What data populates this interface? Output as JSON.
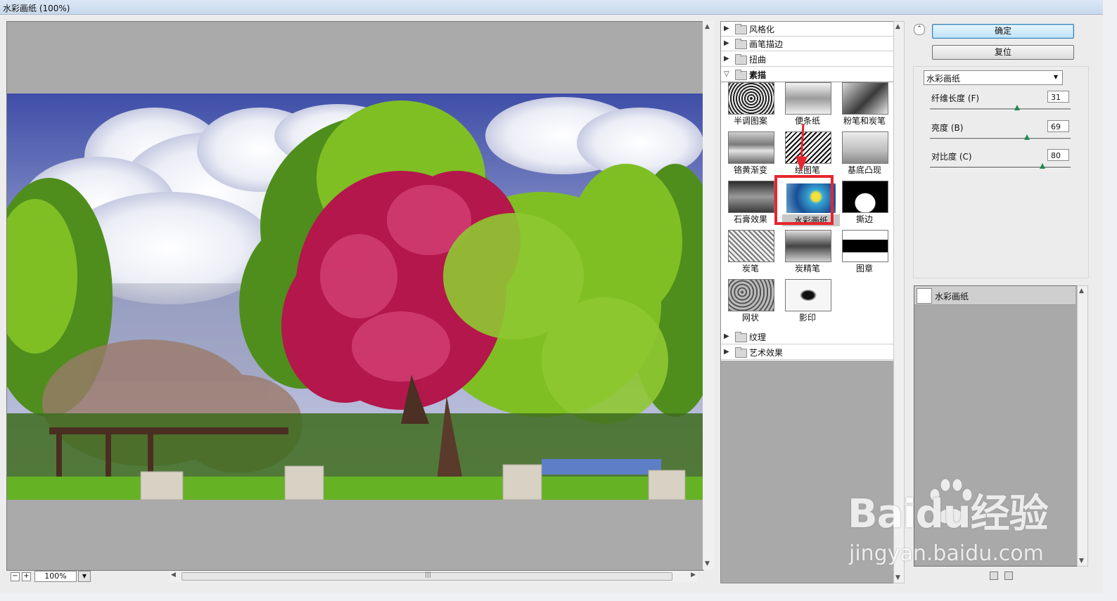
{
  "window": {
    "title": "水彩画纸 (100%)"
  },
  "preview": {
    "zoom": "100%"
  },
  "gallery": {
    "categories_top": [
      {
        "label": "风格化",
        "expanded": false
      },
      {
        "label": "画笔描边",
        "expanded": false
      },
      {
        "label": "扭曲",
        "expanded": false
      },
      {
        "label": "素描",
        "expanded": true
      }
    ],
    "thumbnails": [
      "半调图案",
      "便条纸",
      "粉笔和炭笔",
      "铬黄渐变",
      "绘图笔",
      "基底凸现",
      "石膏效果",
      "水彩画纸",
      "撕边",
      "炭笔",
      "炭精笔",
      "图章",
      "网状",
      "影印"
    ],
    "selected": "水彩画纸",
    "categories_bottom": [
      {
        "label": "纹理",
        "expanded": false
      },
      {
        "label": "艺术效果",
        "expanded": false
      }
    ]
  },
  "controls": {
    "ok_label": "确定",
    "reset_label": "复位",
    "filter_select": "水彩画纸",
    "params": [
      {
        "label": "纤维长度 (F)",
        "value": "31",
        "fraction": 0.62
      },
      {
        "label": "亮度 (B)",
        "value": "69",
        "fraction": 0.69
      },
      {
        "label": "对比度 (C)",
        "value": "80",
        "fraction": 0.8
      }
    ]
  },
  "layers": {
    "items": [
      "水彩画纸"
    ]
  },
  "watermark": {
    "main": "Baidu经验",
    "sub": "jingyan.baidu.com"
  },
  "colors": {
    "selection_box": "#e5262e",
    "ok_button": "#bfe3f8",
    "slider_knob": "#1f8a4e"
  }
}
